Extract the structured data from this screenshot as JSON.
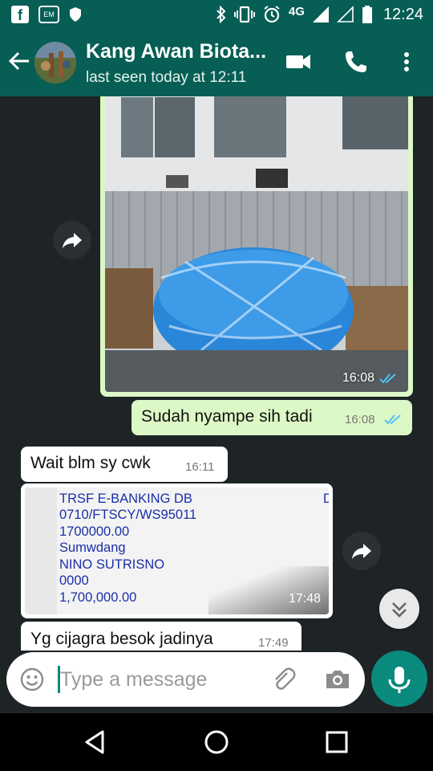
{
  "status_bar": {
    "fb_glyph": "f",
    "app_glyph": "EM",
    "network": "4G",
    "time": "12:24"
  },
  "header": {
    "contact_name": "Kang Awan Biota...",
    "last_seen": "last seen today at 12:11"
  },
  "messages": [
    {
      "type": "image",
      "direction": "outgoing",
      "time": "16:08",
      "status": "read"
    },
    {
      "type": "text",
      "direction": "outgoing",
      "text": "Sudah nyampe sih tadi",
      "time": "16:08",
      "status": "read"
    },
    {
      "type": "text",
      "direction": "incoming",
      "text": "Wait blm sy cwk",
      "time": "16:11"
    },
    {
      "type": "image",
      "direction": "incoming",
      "time": "17:48",
      "document_lines": [
        "TRSF E-BANKING DB",
        "0710/FTSCY/WS95011",
        "1700000.00",
        "Sumwdang",
        "NINO SUTRISNO",
        "0000",
        "1,700,000.00"
      ],
      "edge_mark": "D"
    },
    {
      "type": "text",
      "direction": "incoming",
      "text": "Yg cijagra  besok jadinya",
      "time": "17:49"
    }
  ],
  "composer": {
    "placeholder": "Type a message"
  },
  "colors": {
    "header": "#075e54",
    "accent": "#0a8a7c",
    "outgoing_bubble": "#dcf8c6",
    "incoming_bubble": "#ffffff",
    "read_ticks": "#4fc3f7",
    "chat_bg": "#1e2326"
  },
  "icons": [
    "back-arrow-icon",
    "video-call-icon",
    "phone-icon",
    "more-vert-icon",
    "share-icon",
    "double-chevron-down-icon",
    "emoji-icon",
    "paperclip-icon",
    "camera-icon",
    "mic-icon",
    "nav-back-icon",
    "nav-home-icon",
    "nav-recents-icon"
  ]
}
